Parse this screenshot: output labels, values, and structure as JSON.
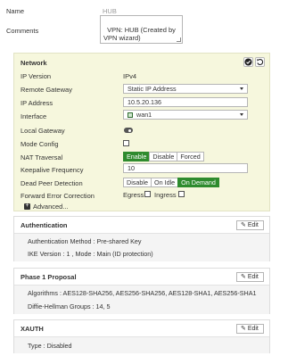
{
  "name": {
    "label": "Name",
    "value": "HUB"
  },
  "comments": {
    "label": "Comments",
    "value": "VPN: HUB (Created by VPN wizard)"
  },
  "network": {
    "title": "Network",
    "ip_version": {
      "label": "IP Version",
      "value": "IPv4"
    },
    "remote_gateway": {
      "label": "Remote Gateway",
      "value": "Static IP Address"
    },
    "ip_address": {
      "label": "IP Address",
      "value": "10.5.20.136"
    },
    "interface": {
      "label": "Interface",
      "value": "wan1"
    },
    "local_gateway": {
      "label": "Local Gateway",
      "enabled": false
    },
    "mode_config": {
      "label": "Mode Config",
      "checked": false
    },
    "nat_traversal": {
      "label": "NAT Traversal",
      "options": [
        "Enable",
        "Disable",
        "Forced"
      ],
      "selected": "Enable"
    },
    "keepalive": {
      "label": "Keepalive Frequency",
      "value": "10"
    },
    "dpd": {
      "label": "Dead Peer Detection",
      "options": [
        "Disable",
        "On Idle",
        "On Demand"
      ],
      "selected": "On Demand"
    },
    "fec": {
      "label": "Forward Error Correction",
      "egress": "Egress",
      "ingress": "Ingress"
    },
    "advanced": "Advanced..."
  },
  "authentication": {
    "title": "Authentication",
    "edit": "Edit",
    "method": "Authentication Method : Pre-shared Key",
    "ike": "IKE Version : 1 , Mode : Main (ID protection)"
  },
  "phase1": {
    "title": "Phase 1 Proposal",
    "edit": "Edit",
    "algorithms": "Algorithms : AES128-SHA256, AES256-SHA256, AES128-SHA1, AES256-SHA1",
    "dh": "Diffie-Hellman Groups : 14, 5"
  },
  "xauth": {
    "title": "XAUTH",
    "edit": "Edit",
    "type": "Type : Disabled"
  },
  "colors": {
    "accent": "#2e8b2e",
    "panel": "#f6f7dd"
  }
}
